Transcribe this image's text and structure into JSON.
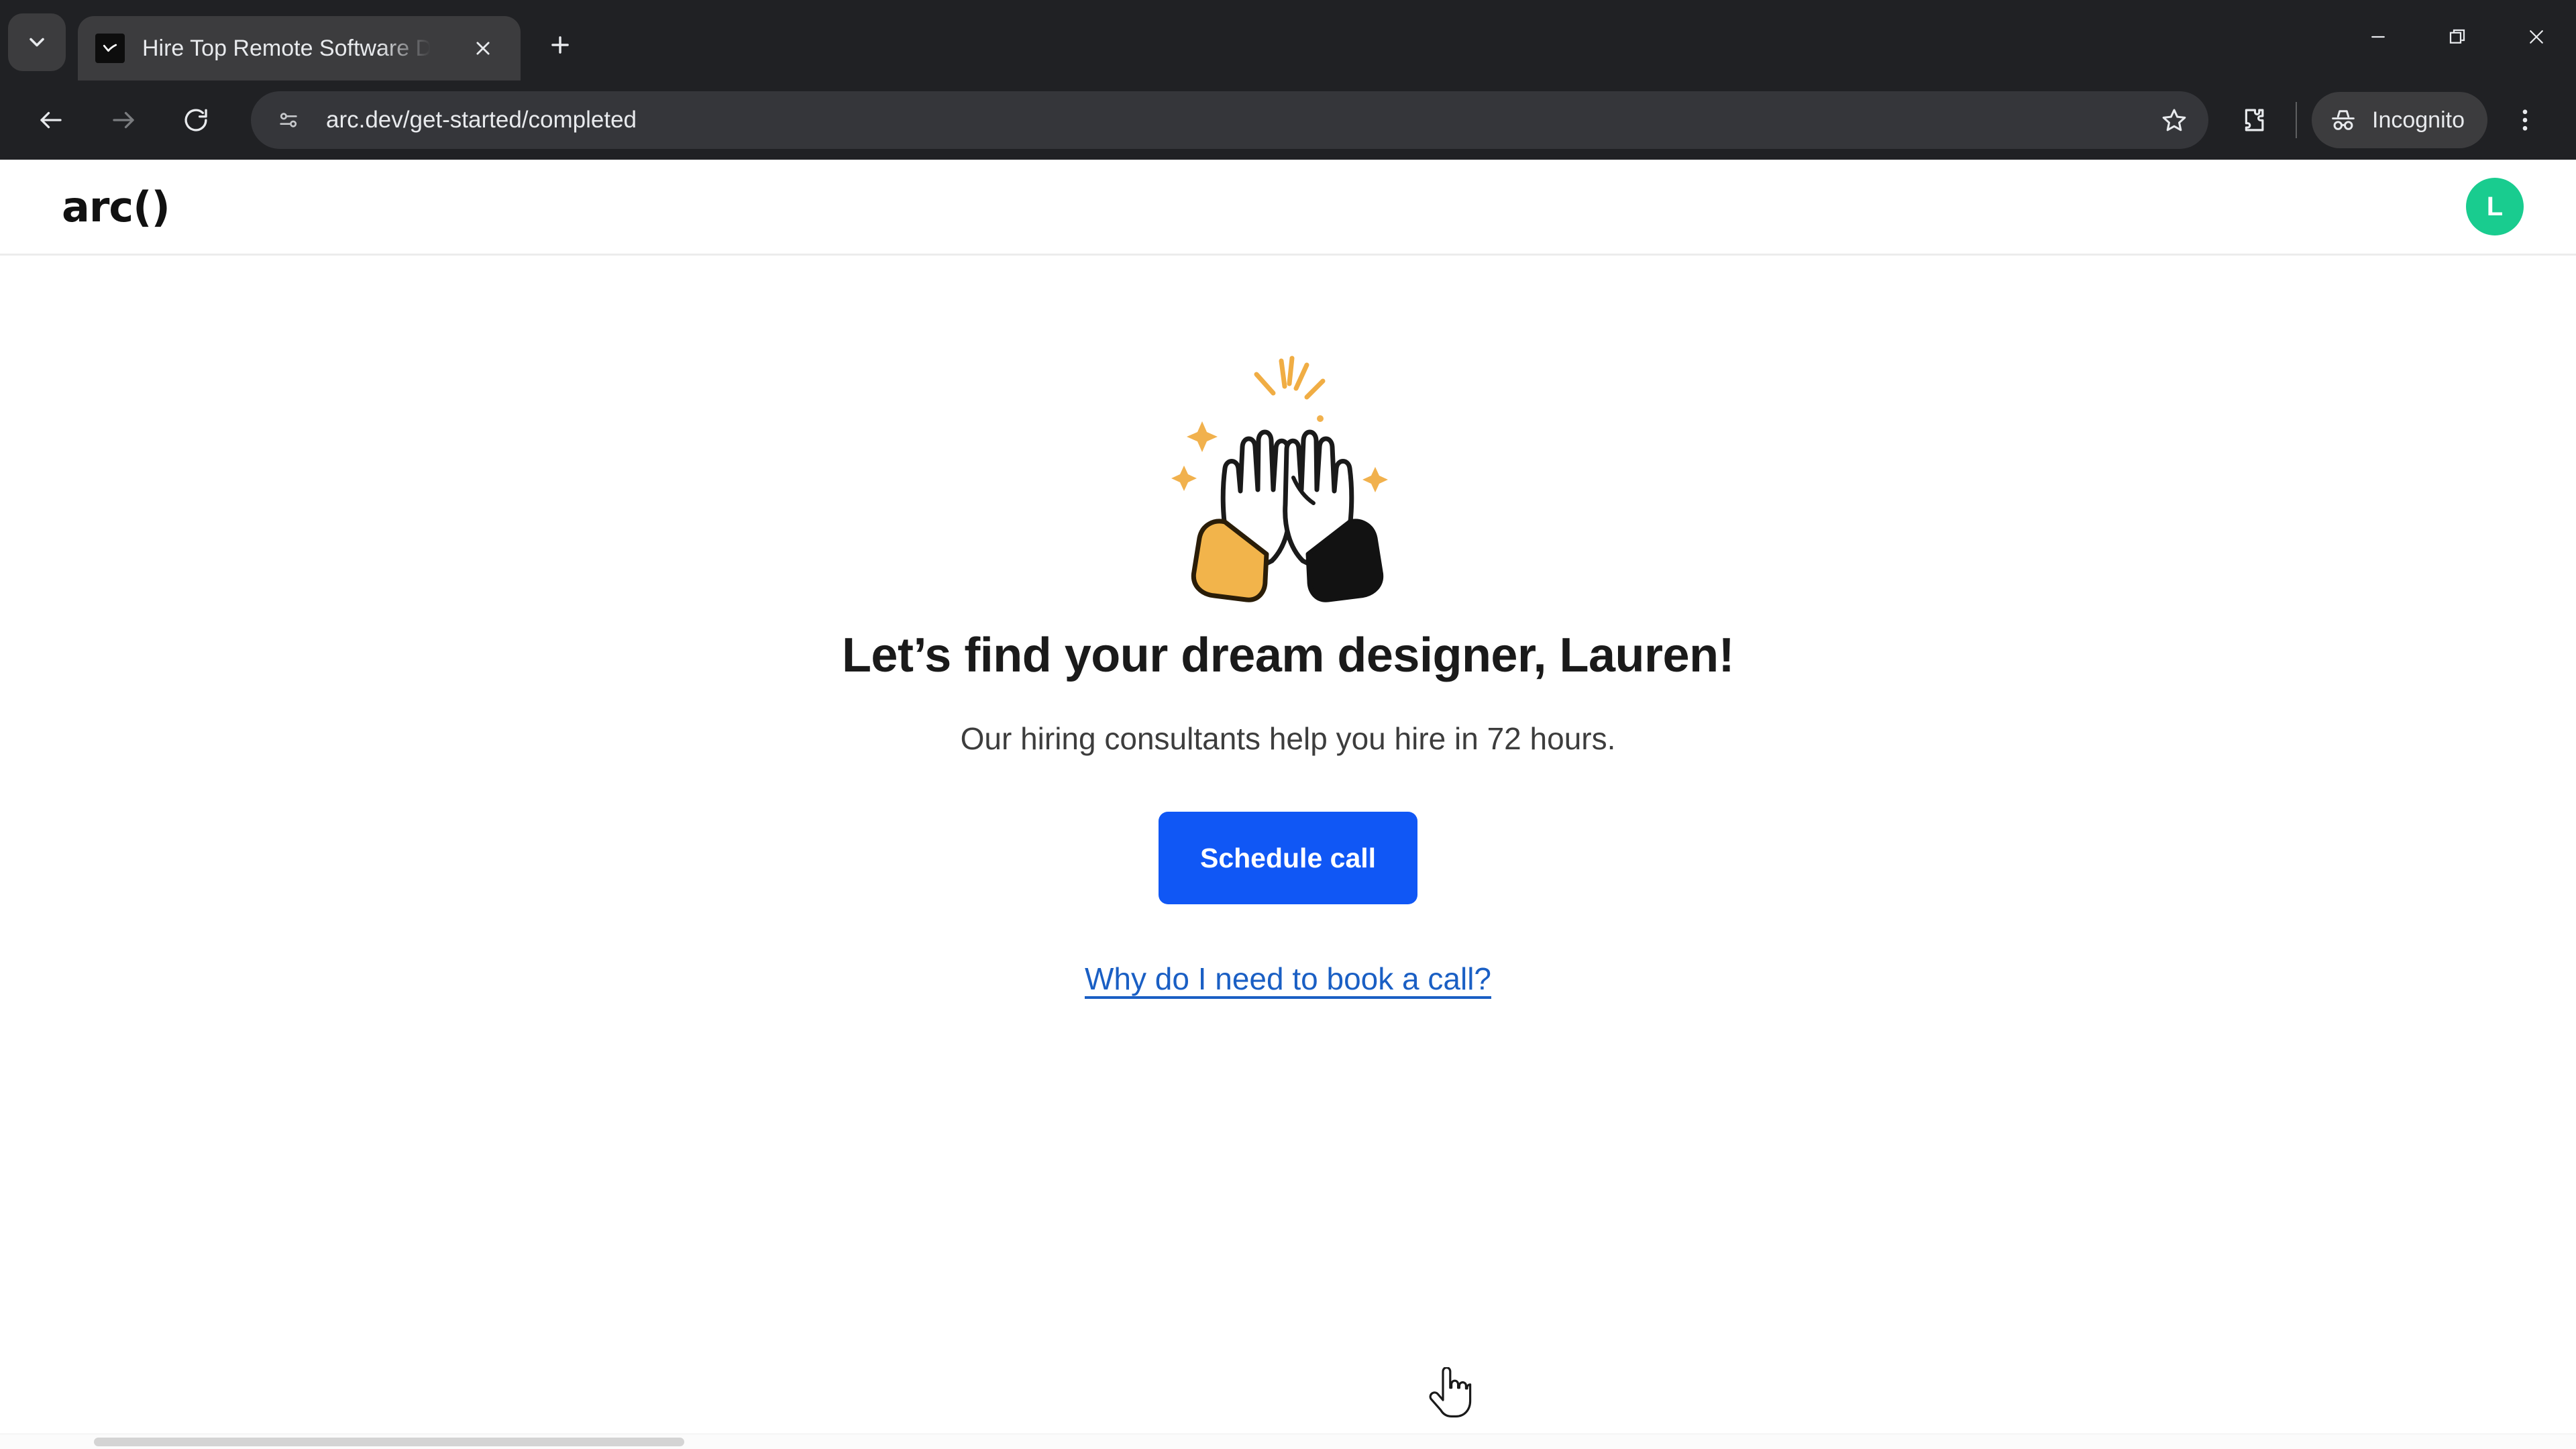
{
  "browser": {
    "tab_search_icon": "chevron-down-icon",
    "tab": {
      "favicon": "arc-check-favicon",
      "title": "Hire Top Remote Software Deve",
      "close_icon": "close-icon"
    },
    "new_tab_icon": "plus-icon",
    "window_controls": {
      "minimize_icon": "minimize-icon",
      "restore_icon": "restore-icon",
      "close_icon": "close-icon"
    },
    "toolbar": {
      "back_icon": "back-arrow-icon",
      "forward_icon": "forward-arrow-icon",
      "reload_icon": "reload-icon",
      "site_info_icon": "site-settings-icon",
      "url": "arc.dev/get-started/completed",
      "bookmark_icon": "star-icon",
      "extensions_icon": "puzzle-piece-icon",
      "incognito_icon": "incognito-icon",
      "incognito_label": "Incognito",
      "menu_icon": "three-dot-menu-icon"
    }
  },
  "page": {
    "header": {
      "logo": "arc()",
      "avatar_initial": "L",
      "avatar_color": "#19cc8f"
    },
    "main": {
      "illustration": "high-five-hands-illustration",
      "headline": "Let’s find your dream designer, Lauren!",
      "subtitle": "Our hiring consultants help you hire in 72 hours.",
      "cta_button_label": "Schedule call",
      "cta_button_color": "#1057f5",
      "help_link_label": "Why do I need to book a call?",
      "help_link_color": "#1a5fc4"
    }
  }
}
